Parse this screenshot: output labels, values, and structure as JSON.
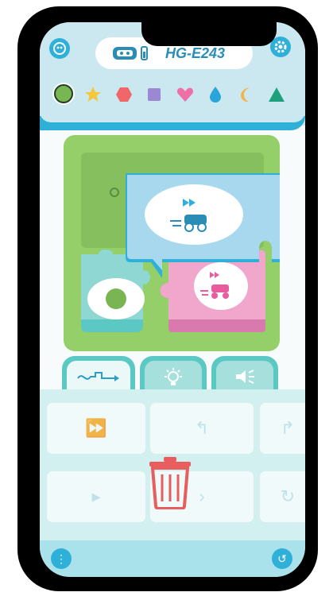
{
  "robot": {
    "name": "HG-E243"
  },
  "colors": {
    "header_bg": "#cbe8f1",
    "accent": "#2fb0d9",
    "board_green": "#95cf69",
    "block_blue": "#a8d8ee",
    "block_pink": "#f1a6cc",
    "block_teal": "#8fd7d3",
    "trash_red": "#e85d5d"
  },
  "header": {
    "left_icon": "robot-face-icon",
    "right_icon": "gear-icon"
  },
  "color_filters": [
    {
      "name": "green-circle",
      "shape": "circle",
      "color": "#79b651",
      "selected": true
    },
    {
      "name": "yellow-star",
      "shape": "star",
      "color": "#f6c63b"
    },
    {
      "name": "red-hexagon",
      "shape": "hexagon",
      "color": "#ef6767"
    },
    {
      "name": "purple-square",
      "shape": "square",
      "color": "#9a88d3"
    },
    {
      "name": "pink-heart",
      "shape": "heart",
      "color": "#ef6fa7"
    },
    {
      "name": "blue-drop",
      "shape": "drop",
      "color": "#2aa5d9"
    },
    {
      "name": "orange-moon",
      "shape": "moon",
      "color": "#f6b34a"
    },
    {
      "name": "green-triangle",
      "shape": "triangle",
      "color": "#1fa07c"
    }
  ],
  "tabs": [
    {
      "name": "movement",
      "icon": "path-arrow-icon",
      "active": true
    },
    {
      "name": "lights",
      "icon": "lightbulb-icon",
      "active": false
    },
    {
      "name": "sound",
      "icon": "speaker-icon",
      "active": false
    }
  ],
  "palette": {
    "blocks": [
      {
        "name": "forward-fast",
        "icon": "robot-forward-fast-icon"
      },
      {
        "name": "turn-left",
        "icon": "turn-left-arrow-icon"
      },
      {
        "name": "turn-right-45",
        "icon": "turn-right-45-icon"
      },
      {
        "name": "forward-slow",
        "icon": "robot-forward-slow-icon"
      },
      {
        "name": "forward-next",
        "icon": "arrow-right-icon"
      },
      {
        "name": "rotate-right",
        "icon": "rotate-right-icon"
      }
    ],
    "overlay_icon": "trash-icon"
  },
  "footer": {
    "left_icon": "more-vertical-icon",
    "right_icon": "undo-icon"
  }
}
